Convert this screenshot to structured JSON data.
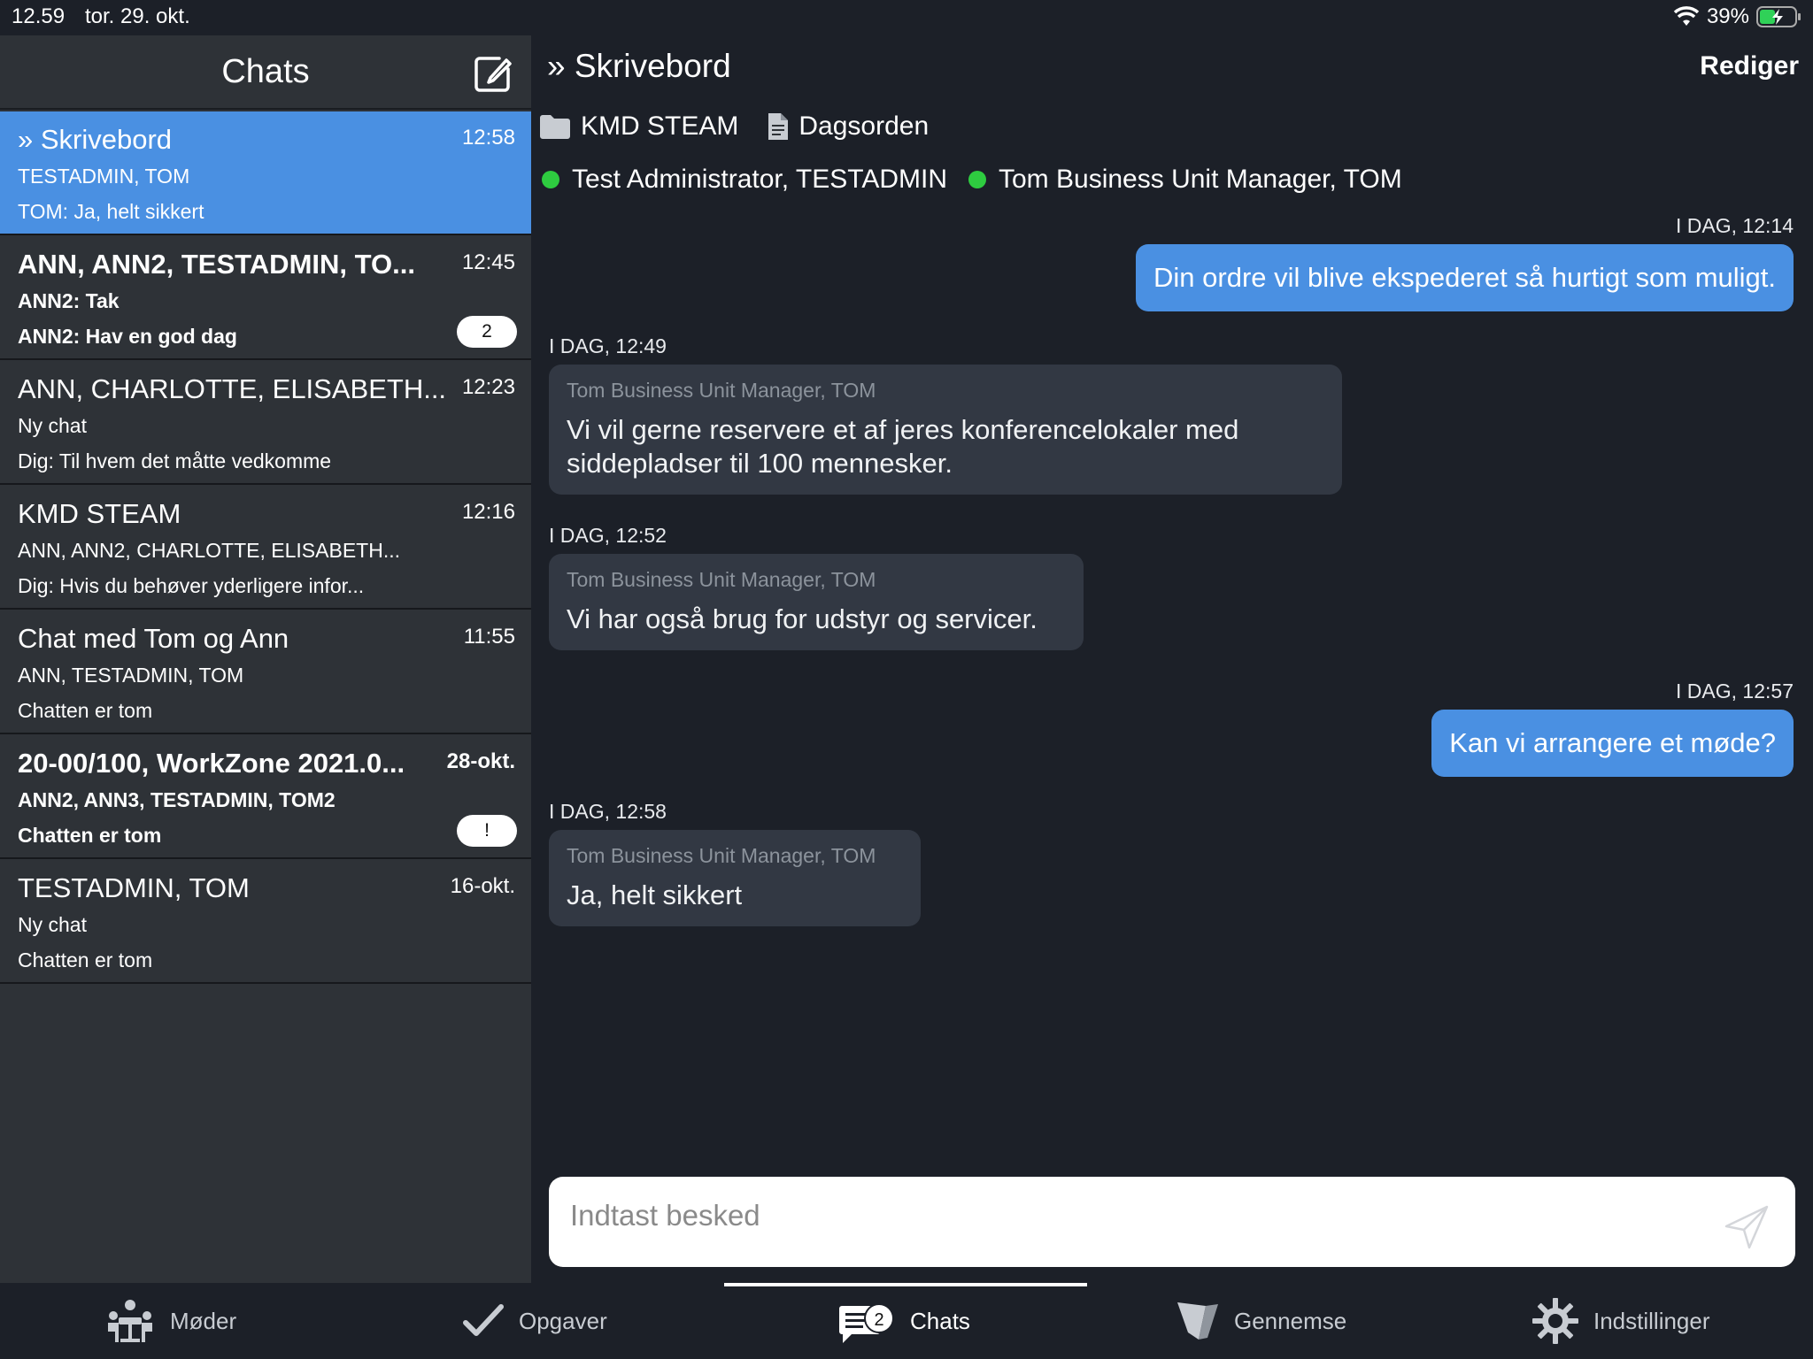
{
  "status_bar": {
    "time": "12.59",
    "date": "tor. 29. okt.",
    "battery": "39%"
  },
  "sidebar": {
    "title": "Chats",
    "chats": [
      {
        "title": "» Skrivebord",
        "time": "12:58",
        "participants": "TESTADMIN, TOM",
        "last_message": "TOM: Ja, helt sikkert",
        "badge": ""
      },
      {
        "title": "ANN, ANN2, TESTADMIN, TO...",
        "time": "12:45",
        "participants": "ANN2: Tak",
        "last_message": "ANN2: Hav en god dag",
        "badge": "2"
      },
      {
        "title": "ANN, CHARLOTTE, ELISABETH...",
        "time": "12:23",
        "participants": "Ny chat",
        "last_message": "Dig: Til hvem det måtte vedkomme",
        "badge": ""
      },
      {
        "title": "KMD STEAM",
        "time": "12:16",
        "participants": "ANN, ANN2, CHARLOTTE, ELISABETH...",
        "last_message": "Dig: Hvis du behøver yderligere infor...",
        "badge": ""
      },
      {
        "title": "Chat med Tom og Ann",
        "time": "11:55",
        "participants": "ANN, TESTADMIN, TOM",
        "last_message": "Chatten er tom",
        "badge": ""
      },
      {
        "title": "20-00/100, WorkZone 2021.0...",
        "time": "28-okt.",
        "participants": "ANN2, ANN3, TESTADMIN, TOM2",
        "last_message": "Chatten er tom",
        "badge": "!"
      },
      {
        "title": "TESTADMIN, TOM",
        "time": "16-okt.",
        "participants": "Ny chat",
        "last_message": "Chatten er tom",
        "badge": ""
      }
    ]
  },
  "main": {
    "title": "» Skrivebord",
    "edit_label": "Rediger",
    "folder": "KMD STEAM",
    "document": "Dagsorden",
    "participants": [
      "Test Administrator, TESTADMIN",
      "Tom Business Unit Manager, TOM"
    ],
    "messages": [
      {
        "timestamp": "I DAG, 12:14",
        "text": "Din ordre vil blive ekspederet så hurtigt som muligt."
      },
      {
        "timestamp": "I DAG, 12:49",
        "sender": "Tom Business Unit Manager, TOM",
        "text": "Vi vil gerne reservere et af jeres konferencelokaler med siddepladser til 100 mennesker."
      },
      {
        "timestamp": "I DAG, 12:52",
        "sender": "Tom Business Unit Manager, TOM",
        "text": "Vi har også brug for udstyr og servicer."
      },
      {
        "timestamp": "I DAG, 12:57",
        "text": "Kan vi arrangere et møde?"
      },
      {
        "timestamp": "I DAG, 12:58",
        "sender": "Tom Business Unit Manager, TOM",
        "text": "Ja, helt sikkert"
      }
    ],
    "input_placeholder": "Indtast besked"
  },
  "tabbar": {
    "tabs": [
      {
        "label": "Møder",
        "icon": "meetings-icon"
      },
      {
        "label": "Opgaver",
        "icon": "checkmark-icon"
      },
      {
        "label": "Chats",
        "icon": "chat-icon",
        "badge": "2"
      },
      {
        "label": "Gennemse",
        "icon": "browse-icon"
      },
      {
        "label": "Indstillinger",
        "icon": "gear-icon"
      }
    ],
    "active_tab": "Chats"
  },
  "colors": {
    "accent": "#4a90e2",
    "online": "#2ecc40",
    "sidebar_bg": "#2e3237",
    "main_bg": "#1c2028",
    "bubble_in": "#323843"
  }
}
